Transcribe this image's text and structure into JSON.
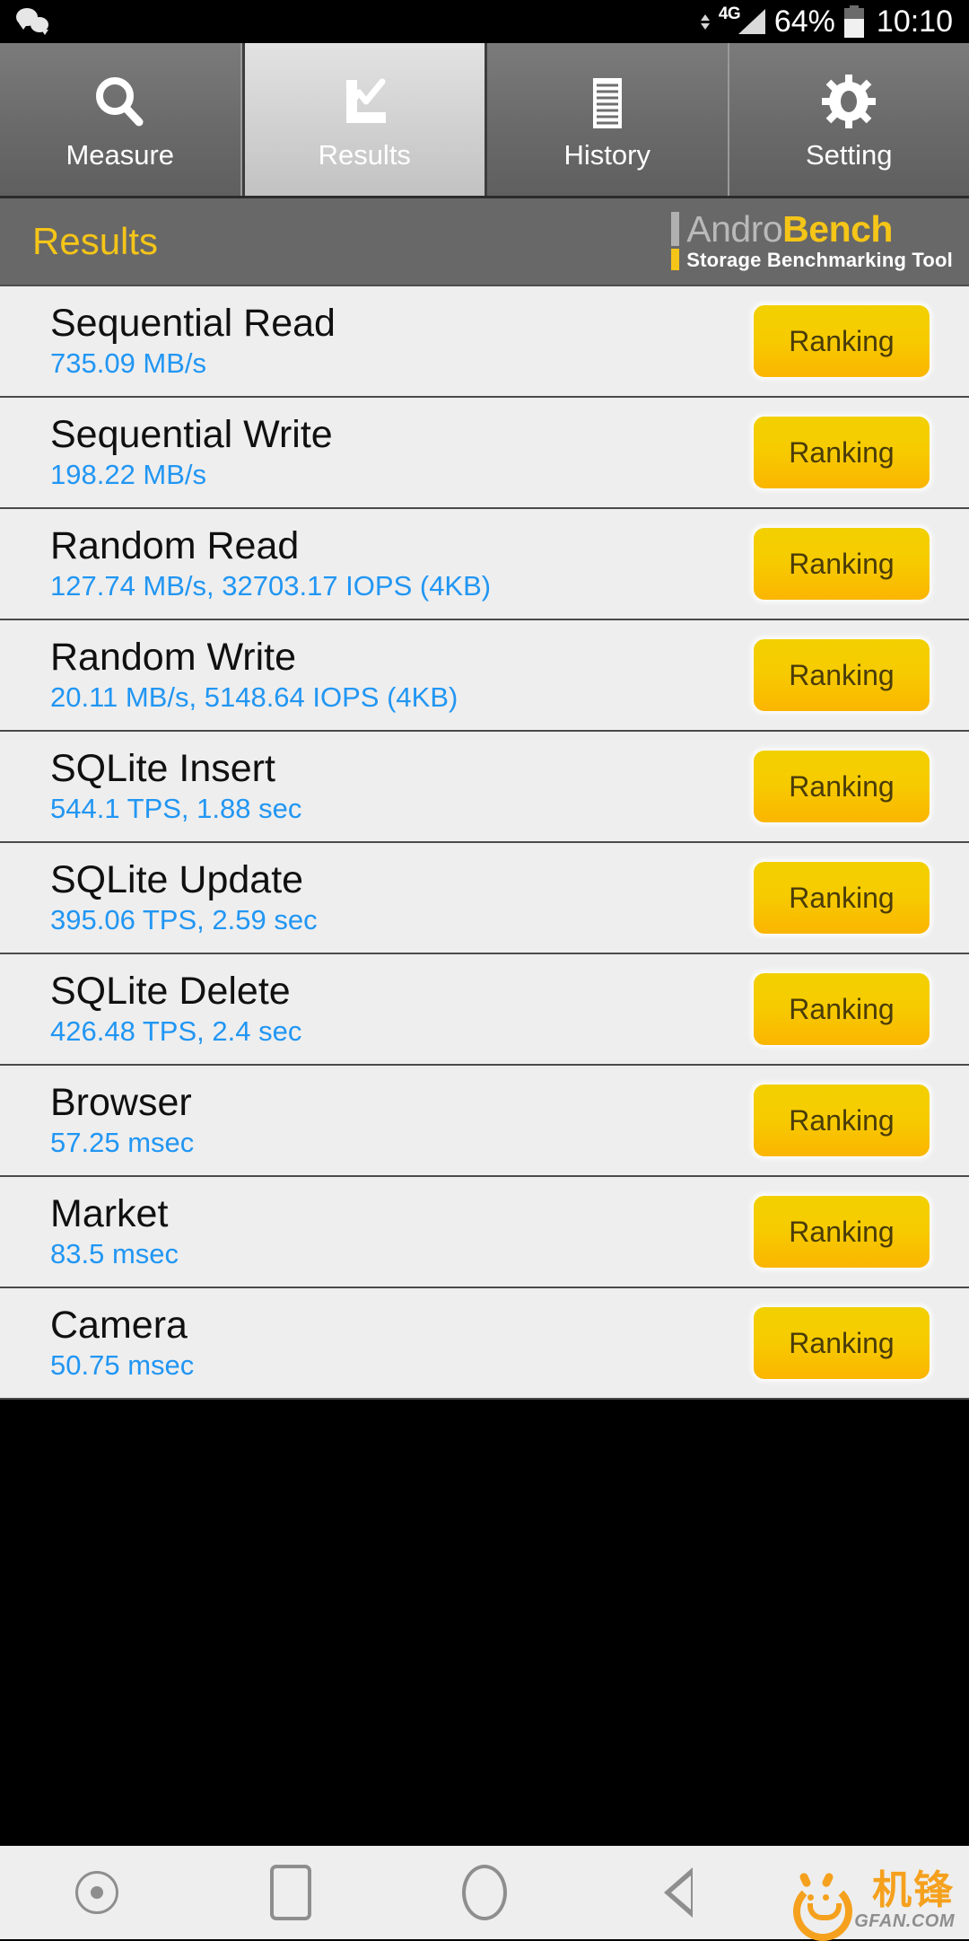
{
  "status_bar": {
    "wechat_icon": "wechat-icon",
    "network_type": "4G",
    "battery_percent": "64%",
    "time": "10:10"
  },
  "tabs": [
    {
      "label": "Measure",
      "icon": "magnifier-icon",
      "active": false
    },
    {
      "label": "Results",
      "icon": "line-chart-icon",
      "active": true
    },
    {
      "label": "History",
      "icon": "list-lines-icon",
      "active": false
    },
    {
      "label": "Setting",
      "icon": "gear-icon",
      "active": false
    }
  ],
  "header": {
    "title": "Results",
    "brand_andro": "Andro",
    "brand_bench": "Bench",
    "brand_subtitle": "Storage Benchmarking Tool"
  },
  "colors": {
    "accent_yellow": "#f5c518",
    "value_blue": "#2196f3",
    "list_bg": "#eeeeee",
    "header_gray": "#686868",
    "button_gradient_start": "#f2d000",
    "button_gradient_end": "#fbb500",
    "watermark_orange": "#f5a11e"
  },
  "results": [
    {
      "title": "Sequential Read",
      "value": "735.09 MB/s",
      "button": "Ranking"
    },
    {
      "title": "Sequential Write",
      "value": "198.22 MB/s",
      "button": "Ranking"
    },
    {
      "title": "Random Read",
      "value": "127.74 MB/s, 32703.17 IOPS (4KB)",
      "button": "Ranking"
    },
    {
      "title": "Random Write",
      "value": "20.11 MB/s, 5148.64 IOPS (4KB)",
      "button": "Ranking"
    },
    {
      "title": "SQLite Insert",
      "value": "544.1 TPS, 1.88 sec",
      "button": "Ranking"
    },
    {
      "title": "SQLite Update",
      "value": "395.06 TPS, 2.59 sec",
      "button": "Ranking"
    },
    {
      "title": "SQLite Delete",
      "value": "426.48 TPS, 2.4 sec",
      "button": "Ranking"
    },
    {
      "title": "Browser",
      "value": "57.25 msec",
      "button": "Ranking"
    },
    {
      "title": "Market",
      "value": "83.5 msec",
      "button": "Ranking"
    },
    {
      "title": "Camera",
      "value": "50.75 msec",
      "button": "Ranking"
    }
  ],
  "nav_bar": {
    "buttons": [
      "screenshot-icon",
      "recents-icon",
      "home-icon",
      "back-icon"
    ]
  },
  "watermark": {
    "brand_cn": "机锋",
    "brand_en": "GFAN.COM"
  }
}
